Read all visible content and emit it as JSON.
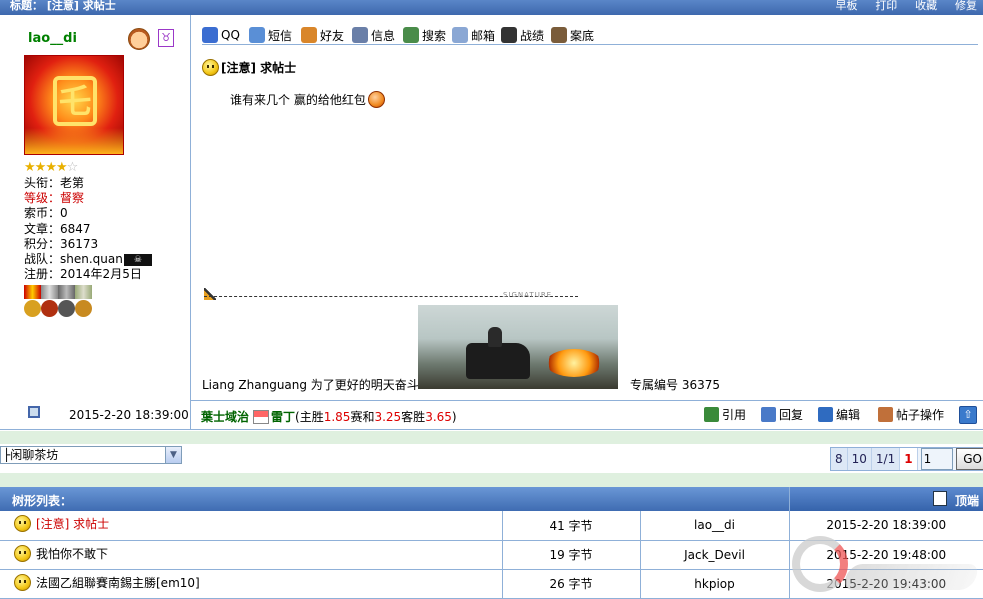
{
  "topbar": {
    "title": "标题： [注意] 求帖士",
    "actions": [
      "早板",
      "打印",
      "收藏",
      "修复"
    ]
  },
  "user": {
    "name": "lao__di",
    "stars": 4,
    "stars_max": 5,
    "avatar_glyph": "乇",
    "gender_glyph": "♉",
    "fields": {
      "title_label": "头衔：",
      "title_value": "老第",
      "rank_label": "等级：",
      "rank_value": "督察",
      "coins_label": "索币：",
      "coins_value": "0",
      "posts_label": "文章：",
      "posts_value": "6847",
      "score_label": "积分：",
      "score_value": "36173",
      "team_label": "战队：",
      "team_value": "shen.quan",
      "joined_label": "注册：",
      "joined_value": "2014年2月5日"
    },
    "team_icon": "☠"
  },
  "toolbar": {
    "items": [
      {
        "label": "QQ",
        "icon": "qq-icon",
        "color": "#3b6dd1"
      },
      {
        "label": "短信",
        "icon": "message-icon",
        "color": "#5a8fd6"
      },
      {
        "label": "好友",
        "icon": "friends-icon",
        "color": "#d9862a"
      },
      {
        "label": "信息",
        "icon": "info-icon",
        "color": "#6a7fa8"
      },
      {
        "label": "搜索",
        "icon": "search-icon",
        "color": "#4a8c4a"
      },
      {
        "label": "邮箱",
        "icon": "mail-icon",
        "color": "#8aa7d4"
      },
      {
        "label": "战绩",
        "icon": "record-icon",
        "color": "#333333"
      },
      {
        "label": "案底",
        "icon": "case-icon",
        "color": "#7a5c3a"
      }
    ]
  },
  "post": {
    "title": "[注意] 求帖士",
    "body": "谁有来几个  赢的给他红包",
    "signature_tag": "SIGNATURE",
    "signature_left": "Liang Zhanguang    为了更好的明天奋斗",
    "signature_right": "专属编号 36375",
    "date": "2015-2-20 18:39:00"
  },
  "bet": {
    "team1": "葉士域治",
    "team2": "雷丁",
    "open": " (主胜",
    "home_win": "1.85",
    "draw_label": " 赛和",
    "draw": "3.25",
    "away_label": " 客胜",
    "away_win": "3.65",
    "close": ")"
  },
  "post_actions": [
    {
      "label": "引用",
      "icon": "quote-icon",
      "color": "#3a8a3a"
    },
    {
      "label": "回复",
      "icon": "reply-icon",
      "color": "#4a7ac8"
    },
    {
      "label": "编辑",
      "icon": "edit-icon",
      "color": "#2f6bc0"
    },
    {
      "label": "帖子操作",
      "icon": "post-ops-icon",
      "color": "#c0703a"
    }
  ],
  "top_button": "⇧",
  "forum_select": {
    "selected": "├闲聊茶坊",
    "arrow": "▼"
  },
  "pager": {
    "pages": [
      "8",
      "10",
      "1/1"
    ],
    "current": "1",
    "input_value": "1",
    "go_label": "GO"
  },
  "tree": {
    "header": "树形列表：",
    "right_label": "顶端",
    "rows": [
      {
        "subject": "[注意] 求帖士",
        "size": "41 字节",
        "author": "lao__di",
        "time": "2015-2-20 18:39:00",
        "current": true
      },
      {
        "subject": "我怕你不敢下",
        "size": "19 字节",
        "author": "Jack_Devil",
        "time": "2015-2-20 19:48:00",
        "current": false
      },
      {
        "subject": "法國乙組聯賽南錫主勝[em10]",
        "size": "26 字节",
        "author": "hkpiop",
        "time": "2015-2-20 19:43:00",
        "current": false
      }
    ]
  }
}
